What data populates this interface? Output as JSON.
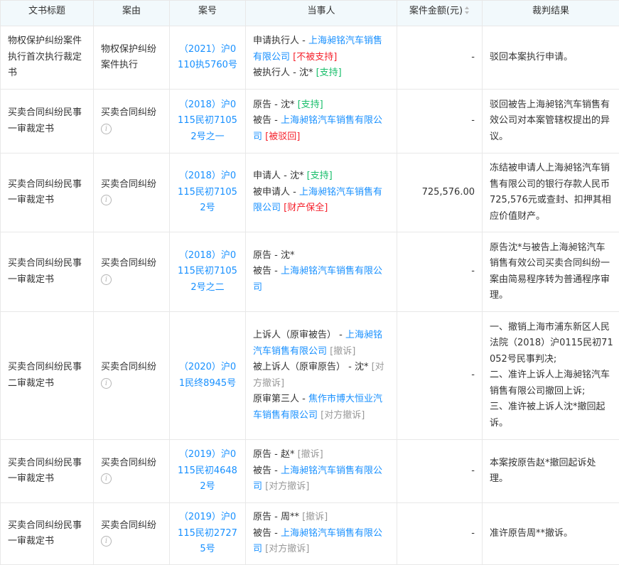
{
  "header": {
    "title": "文书标题",
    "reason": "案由",
    "case_no": "案号",
    "parties": "当事人",
    "amount": "案件金额(元)",
    "result": "裁判结果"
  },
  "rows": [
    {
      "title": "物权保护纠纷案件执行首次执行裁定书",
      "reason": "物权保护纠纷案件执行",
      "case_no": "（2021）沪0110执5760号",
      "parties": [
        {
          "role": "申请执行人 - ",
          "name": "上海昶铭汽车销售有限公司",
          "tag": "[不被支持]"
        },
        {
          "role": "被执行人 - 沈* ",
          "name": "",
          "tag": "[支持]"
        }
      ],
      "amount": "-",
      "result": "驳回本案执行申请。"
    },
    {
      "title": "买卖合同纠纷民事一审裁定书",
      "reason": "买卖合同纠纷",
      "case_no": "（2018）沪0115民初71052号之一",
      "parties": [
        {
          "role": "原告 - 沈* ",
          "name": "",
          "tag": "[支持]"
        },
        {
          "role": "被告 - ",
          "name": "上海昶铭汽车销售有限公司",
          "tag": "[被驳回]"
        }
      ],
      "amount": "-",
      "result": "驳回被告上海昶铭汽车销售有效公司对本案管辖权提出的异议。"
    },
    {
      "title": "买卖合同纠纷民事一审裁定书",
      "reason": "买卖合同纠纷",
      "case_no": "（2018）沪0115民初71052号",
      "parties": [
        {
          "role": "申请人 - 沈* ",
          "name": "",
          "tag": "[支持]"
        },
        {
          "role": "被申请人 - ",
          "name": "上海昶铭汽车销售有限公司",
          "tag": "[财产保全]"
        }
      ],
      "amount": "725,576.00",
      "result": "冻结被申请人上海昶铭汽车销售有限公司的银行存款人民币725,576元或查封、扣押其相应价值财产。"
    },
    {
      "title": "买卖合同纠纷民事一审裁定书",
      "reason": "买卖合同纠纷",
      "case_no": "（2018）沪0115民初71052号之二",
      "parties": [
        {
          "role": "原告 - 沈*",
          "name": "",
          "tag": ""
        },
        {
          "role": "被告 - ",
          "name": "上海昶铭汽车销售有限公司",
          "tag": ""
        }
      ],
      "amount": "-",
      "result": "原告沈*与被告上海昶铭汽车销售有效公司买卖合同纠纷一案由简易程序转为普通程序审理。"
    },
    {
      "title": "买卖合同纠纷民事二审裁定书",
      "reason": "买卖合同纠纷",
      "case_no": "（2020）沪01民终8945号",
      "parties": [
        {
          "role": "上诉人（原审被告） - ",
          "name": "上海昶铭汽车销售有限公司",
          "tag": "[撤诉]"
        },
        {
          "role": "被上诉人（原审原告） - 沈* ",
          "name": "",
          "tag": "[对方撤诉]"
        },
        {
          "role": "原审第三人 - ",
          "name": "焦作市博大恒业汽车销售有限公司",
          "tag": "[对方撤诉]"
        }
      ],
      "amount": "-",
      "result_lines": [
        "一、撤销上海市浦东新区人民法院（2018）沪0115民初71052号民事判决;",
        "二、准许上诉人上海昶铭汽车销售有限公司撤回上诉;",
        "三、准许被上诉人沈*撤回起诉。"
      ]
    },
    {
      "title": "买卖合同纠纷民事一审裁定书",
      "reason": "买卖合同纠纷",
      "case_no": "（2019）沪0115民初46482号",
      "parties": [
        {
          "role": "原告 - 赵* ",
          "name": "",
          "tag": "[撤诉]"
        },
        {
          "role": "被告 - ",
          "name": "上海昶铭汽车销售有限公司",
          "tag": "[对方撤诉]"
        }
      ],
      "amount": "-",
      "result": "本案按原告赵*撤回起诉处理。"
    },
    {
      "title": "买卖合同纠纷民事一审裁定书",
      "reason": "买卖合同纠纷",
      "case_no": "（2019）沪0115民初27275号",
      "parties": [
        {
          "role": "原告 - 周** ",
          "name": "",
          "tag": "[撤诉]"
        },
        {
          "role": "被告 - ",
          "name": "上海昶铭汽车销售有限公司",
          "tag": "[对方撤诉]"
        }
      ],
      "amount": "-",
      "result": "准许原告周**撤诉。"
    }
  ],
  "colors": {
    "link": "#1890ff",
    "support": "#19be6b",
    "reject": "#f5222d",
    "withdraw": "#999999",
    "header_bg": "#f2f9fc"
  },
  "icons": {
    "info": "info-circle-icon",
    "sort": "sort-caret-icon"
  }
}
